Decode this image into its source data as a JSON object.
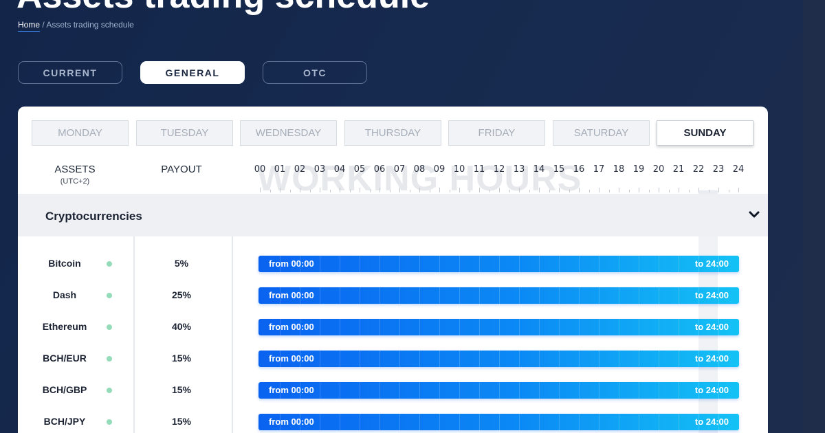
{
  "page": {
    "title": "Assets trading schedule"
  },
  "breadcrumb": {
    "home": "Home",
    "separator": "/",
    "current": "Assets trading schedule"
  },
  "mode_tabs": [
    {
      "label": "CURRENT",
      "active": false
    },
    {
      "label": "GENERAL",
      "active": true
    },
    {
      "label": "OTC",
      "active": false
    }
  ],
  "days": [
    {
      "label": "MONDAY",
      "active": false
    },
    {
      "label": "TUESDAY",
      "active": false
    },
    {
      "label": "WEDNESDAY",
      "active": false
    },
    {
      "label": "THURSDAY",
      "active": false
    },
    {
      "label": "FRIDAY",
      "active": false
    },
    {
      "label": "SATURDAY",
      "active": false
    },
    {
      "label": "SUNDAY",
      "active": true
    }
  ],
  "table": {
    "assets_header": "ASSETS",
    "timezone": "(UTC+2)",
    "payout_header": "PAYOUT",
    "watermark": "WORKING HOURS",
    "hours": [
      "00",
      "01",
      "02",
      "03",
      "04",
      "05",
      "06",
      "07",
      "08",
      "09",
      "10",
      "11",
      "12",
      "13",
      "14",
      "15",
      "16",
      "17",
      "18",
      "19",
      "20",
      "21",
      "22",
      "23",
      "24"
    ],
    "current_hour": "22"
  },
  "category": {
    "name": "Cryptocurrencies",
    "expand_icon": "chevron-down-icon"
  },
  "assets": [
    {
      "name": "Bitcoin",
      "payout": "5%",
      "from": "from 00:00",
      "to": "to 24:00",
      "status_color": "#4cc38a"
    },
    {
      "name": "Dash",
      "payout": "25%",
      "from": "from 00:00",
      "to": "to 24:00",
      "status_color": "#4cc38a"
    },
    {
      "name": "Ethereum",
      "payout": "40%",
      "from": "from 00:00",
      "to": "to 24:00",
      "status_color": "#4cc38a"
    },
    {
      "name": "BCH/EUR",
      "payout": "15%",
      "from": "from 00:00",
      "to": "to 24:00",
      "status_color": "#4cc38a"
    },
    {
      "name": "BCH/GBP",
      "payout": "15%",
      "from": "from 00:00",
      "to": "to 24:00",
      "status_color": "#4cc38a"
    },
    {
      "name": "BCH/JPY",
      "payout": "15%",
      "from": "from 00:00",
      "to": "to 24:00",
      "status_color": "#4cc38a"
    }
  ],
  "colors": {
    "bar_start": "#0a63f0",
    "bar_end": "#14c2f5",
    "status_open": "#4cc38a",
    "background": "#13264a"
  }
}
